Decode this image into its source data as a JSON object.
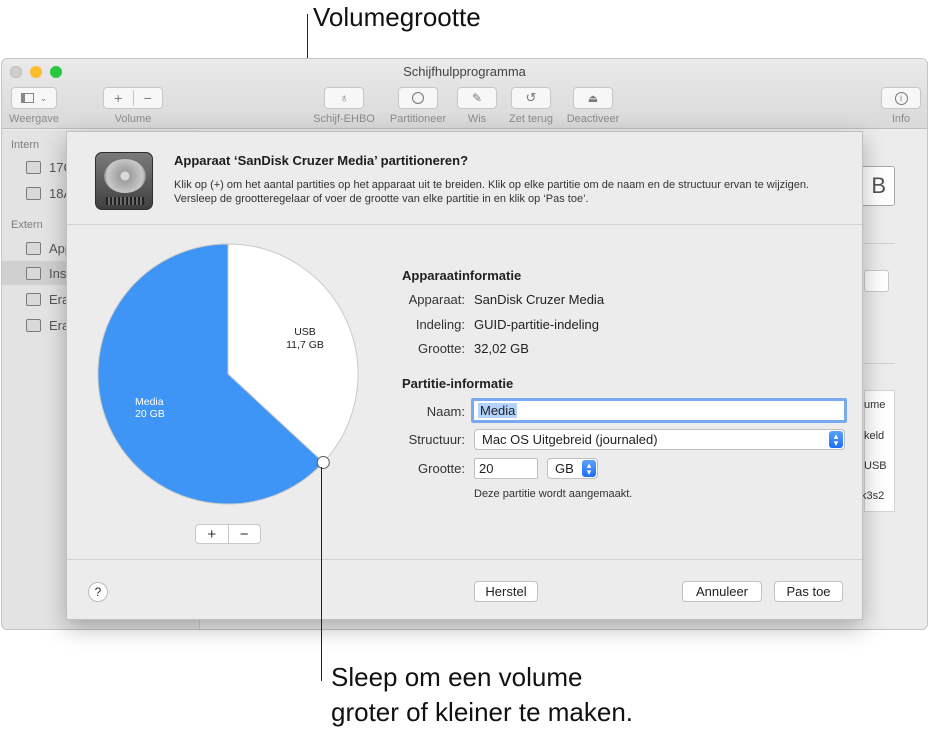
{
  "annotations": {
    "volume_size": "Volumegrootte",
    "drag_line1": "Sleep om een volume",
    "drag_line2": "groter of kleiner te maken."
  },
  "window": {
    "title": "Schijfhulpprogramma",
    "traffic_colors": [
      "#fd5f57",
      "#fdbc2e",
      "#28c840"
    ]
  },
  "toolbar": {
    "view_label": "Weergave",
    "volume_label": "Volume",
    "volume_add": "+",
    "volume_remove": "−",
    "first_aid_label": "Schijf-EHBO",
    "partition_label": "Partitioneer",
    "erase_label": "Wis",
    "restore_label": "Zet terug",
    "unmount_label": "Deactiveer",
    "info_label": "Info"
  },
  "sidebar": {
    "internal_header": "Intern",
    "external_header": "Extern",
    "internal_items": [
      "17G",
      "18A"
    ],
    "external_items": [
      "App",
      "Inst",
      "Era",
      "Era"
    ]
  },
  "background_fragments": [
    "B",
    "ume",
    "keld",
    "USB",
    "k3s2"
  ],
  "sheet": {
    "title": "Apparaat ‘SanDisk Cruzer Media’ partitioneren?",
    "description": "Klik op (+) om het aantal partities op het apparaat uit te breiden. Klik op elke partitie om de naam en de structuur ervan te wijzigen. Versleep de grootteregelaar of voer de grootte van elke partitie in en klik op ‘Pas toe’.",
    "pie_add": "+",
    "pie_remove": "−",
    "device_info": {
      "heading": "Apparaatinformatie",
      "device_label": "Apparaat:",
      "device_value": "SanDisk Cruzer Media",
      "scheme_label": "Indeling:",
      "scheme_value": "GUID-partitie-indeling",
      "size_label": "Grootte:",
      "size_value": "32,02 GB"
    },
    "partition_info": {
      "heading": "Partitie-informatie",
      "name_label": "Naam:",
      "name_value": "Media",
      "format_label": "Structuur:",
      "format_value": "Mac OS Uitgebreid (journaled)",
      "size_label": "Grootte:",
      "size_value": "20",
      "unit_value": "GB",
      "note": "Deze partitie wordt aangemaakt."
    },
    "buttons": {
      "help": "?",
      "revert": "Herstel",
      "cancel": "Annuleer",
      "apply": "Pas toe"
    }
  },
  "chart_data": {
    "type": "pie",
    "slices": [
      {
        "name": "Media",
        "size_label": "20 GB",
        "value": 20,
        "color": "#3e95f5"
      },
      {
        "name": "USB",
        "size_label": "11,7 GB",
        "value": 11.7,
        "color": "#ffffff"
      }
    ]
  }
}
